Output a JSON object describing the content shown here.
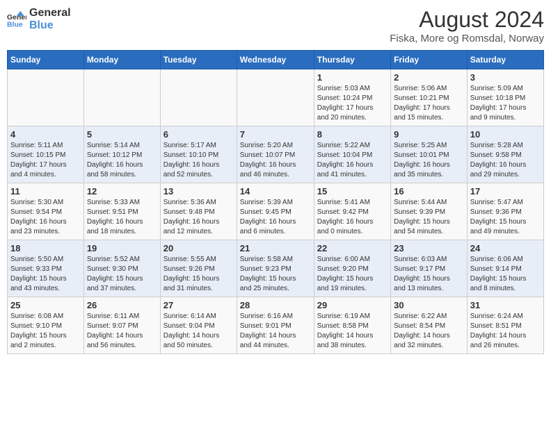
{
  "logo": {
    "text_general": "General",
    "text_blue": "Blue"
  },
  "title": "August 2024",
  "subtitle": "Fiska, More og Romsdal, Norway",
  "header_days": [
    "Sunday",
    "Monday",
    "Tuesday",
    "Wednesday",
    "Thursday",
    "Friday",
    "Saturday"
  ],
  "weeks": [
    [
      {
        "day": "",
        "info": ""
      },
      {
        "day": "",
        "info": ""
      },
      {
        "day": "",
        "info": ""
      },
      {
        "day": "",
        "info": ""
      },
      {
        "day": "1",
        "info": "Sunrise: 5:03 AM\nSunset: 10:24 PM\nDaylight: 17 hours\nand 20 minutes."
      },
      {
        "day": "2",
        "info": "Sunrise: 5:06 AM\nSunset: 10:21 PM\nDaylight: 17 hours\nand 15 minutes."
      },
      {
        "day": "3",
        "info": "Sunrise: 5:09 AM\nSunset: 10:18 PM\nDaylight: 17 hours\nand 9 minutes."
      }
    ],
    [
      {
        "day": "4",
        "info": "Sunrise: 5:11 AM\nSunset: 10:15 PM\nDaylight: 17 hours\nand 4 minutes."
      },
      {
        "day": "5",
        "info": "Sunrise: 5:14 AM\nSunset: 10:12 PM\nDaylight: 16 hours\nand 58 minutes."
      },
      {
        "day": "6",
        "info": "Sunrise: 5:17 AM\nSunset: 10:10 PM\nDaylight: 16 hours\nand 52 minutes."
      },
      {
        "day": "7",
        "info": "Sunrise: 5:20 AM\nSunset: 10:07 PM\nDaylight: 16 hours\nand 46 minutes."
      },
      {
        "day": "8",
        "info": "Sunrise: 5:22 AM\nSunset: 10:04 PM\nDaylight: 16 hours\nand 41 minutes."
      },
      {
        "day": "9",
        "info": "Sunrise: 5:25 AM\nSunset: 10:01 PM\nDaylight: 16 hours\nand 35 minutes."
      },
      {
        "day": "10",
        "info": "Sunrise: 5:28 AM\nSunset: 9:58 PM\nDaylight: 16 hours\nand 29 minutes."
      }
    ],
    [
      {
        "day": "11",
        "info": "Sunrise: 5:30 AM\nSunset: 9:54 PM\nDaylight: 16 hours\nand 23 minutes."
      },
      {
        "day": "12",
        "info": "Sunrise: 5:33 AM\nSunset: 9:51 PM\nDaylight: 16 hours\nand 18 minutes."
      },
      {
        "day": "13",
        "info": "Sunrise: 5:36 AM\nSunset: 9:48 PM\nDaylight: 16 hours\nand 12 minutes."
      },
      {
        "day": "14",
        "info": "Sunrise: 5:39 AM\nSunset: 9:45 PM\nDaylight: 16 hours\nand 6 minutes."
      },
      {
        "day": "15",
        "info": "Sunrise: 5:41 AM\nSunset: 9:42 PM\nDaylight: 16 hours\nand 0 minutes."
      },
      {
        "day": "16",
        "info": "Sunrise: 5:44 AM\nSunset: 9:39 PM\nDaylight: 15 hours\nand 54 minutes."
      },
      {
        "day": "17",
        "info": "Sunrise: 5:47 AM\nSunset: 9:36 PM\nDaylight: 15 hours\nand 49 minutes."
      }
    ],
    [
      {
        "day": "18",
        "info": "Sunrise: 5:50 AM\nSunset: 9:33 PM\nDaylight: 15 hours\nand 43 minutes."
      },
      {
        "day": "19",
        "info": "Sunrise: 5:52 AM\nSunset: 9:30 PM\nDaylight: 15 hours\nand 37 minutes."
      },
      {
        "day": "20",
        "info": "Sunrise: 5:55 AM\nSunset: 9:26 PM\nDaylight: 15 hours\nand 31 minutes."
      },
      {
        "day": "21",
        "info": "Sunrise: 5:58 AM\nSunset: 9:23 PM\nDaylight: 15 hours\nand 25 minutes."
      },
      {
        "day": "22",
        "info": "Sunrise: 6:00 AM\nSunset: 9:20 PM\nDaylight: 15 hours\nand 19 minutes."
      },
      {
        "day": "23",
        "info": "Sunrise: 6:03 AM\nSunset: 9:17 PM\nDaylight: 15 hours\nand 13 minutes."
      },
      {
        "day": "24",
        "info": "Sunrise: 6:06 AM\nSunset: 9:14 PM\nDaylight: 15 hours\nand 8 minutes."
      }
    ],
    [
      {
        "day": "25",
        "info": "Sunrise: 6:08 AM\nSunset: 9:10 PM\nDaylight: 15 hours\nand 2 minutes."
      },
      {
        "day": "26",
        "info": "Sunrise: 6:11 AM\nSunset: 9:07 PM\nDaylight: 14 hours\nand 56 minutes."
      },
      {
        "day": "27",
        "info": "Sunrise: 6:14 AM\nSunset: 9:04 PM\nDaylight: 14 hours\nand 50 minutes."
      },
      {
        "day": "28",
        "info": "Sunrise: 6:16 AM\nSunset: 9:01 PM\nDaylight: 14 hours\nand 44 minutes."
      },
      {
        "day": "29",
        "info": "Sunrise: 6:19 AM\nSunset: 8:58 PM\nDaylight: 14 hours\nand 38 minutes."
      },
      {
        "day": "30",
        "info": "Sunrise: 6:22 AM\nSunset: 8:54 PM\nDaylight: 14 hours\nand 32 minutes."
      },
      {
        "day": "31",
        "info": "Sunrise: 6:24 AM\nSunset: 8:51 PM\nDaylight: 14 hours\nand 26 minutes."
      }
    ]
  ]
}
